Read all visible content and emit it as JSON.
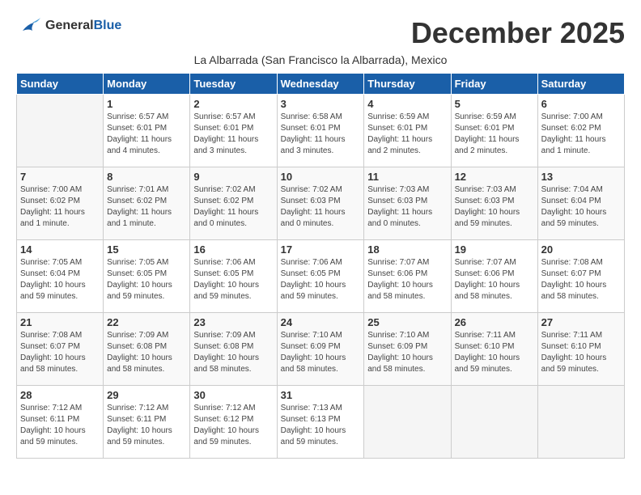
{
  "header": {
    "logo": {
      "general": "General",
      "blue": "Blue"
    },
    "month_title": "December 2025",
    "subtitle": "La Albarrada (San Francisco la Albarrada), Mexico"
  },
  "calendar": {
    "days_of_week": [
      "Sunday",
      "Monday",
      "Tuesday",
      "Wednesday",
      "Thursday",
      "Friday",
      "Saturday"
    ],
    "weeks": [
      [
        {
          "day": "",
          "info": ""
        },
        {
          "day": "1",
          "info": "Sunrise: 6:57 AM\nSunset: 6:01 PM\nDaylight: 11 hours\nand 4 minutes."
        },
        {
          "day": "2",
          "info": "Sunrise: 6:57 AM\nSunset: 6:01 PM\nDaylight: 11 hours\nand 3 minutes."
        },
        {
          "day": "3",
          "info": "Sunrise: 6:58 AM\nSunset: 6:01 PM\nDaylight: 11 hours\nand 3 minutes."
        },
        {
          "day": "4",
          "info": "Sunrise: 6:59 AM\nSunset: 6:01 PM\nDaylight: 11 hours\nand 2 minutes."
        },
        {
          "day": "5",
          "info": "Sunrise: 6:59 AM\nSunset: 6:01 PM\nDaylight: 11 hours\nand 2 minutes."
        },
        {
          "day": "6",
          "info": "Sunrise: 7:00 AM\nSunset: 6:02 PM\nDaylight: 11 hours\nand 1 minute."
        }
      ],
      [
        {
          "day": "7",
          "info": "Sunrise: 7:00 AM\nSunset: 6:02 PM\nDaylight: 11 hours\nand 1 minute."
        },
        {
          "day": "8",
          "info": "Sunrise: 7:01 AM\nSunset: 6:02 PM\nDaylight: 11 hours\nand 1 minute."
        },
        {
          "day": "9",
          "info": "Sunrise: 7:02 AM\nSunset: 6:02 PM\nDaylight: 11 hours\nand 0 minutes."
        },
        {
          "day": "10",
          "info": "Sunrise: 7:02 AM\nSunset: 6:03 PM\nDaylight: 11 hours\nand 0 minutes."
        },
        {
          "day": "11",
          "info": "Sunrise: 7:03 AM\nSunset: 6:03 PM\nDaylight: 11 hours\nand 0 minutes."
        },
        {
          "day": "12",
          "info": "Sunrise: 7:03 AM\nSunset: 6:03 PM\nDaylight: 10 hours\nand 59 minutes."
        },
        {
          "day": "13",
          "info": "Sunrise: 7:04 AM\nSunset: 6:04 PM\nDaylight: 10 hours\nand 59 minutes."
        }
      ],
      [
        {
          "day": "14",
          "info": "Sunrise: 7:05 AM\nSunset: 6:04 PM\nDaylight: 10 hours\nand 59 minutes."
        },
        {
          "day": "15",
          "info": "Sunrise: 7:05 AM\nSunset: 6:05 PM\nDaylight: 10 hours\nand 59 minutes."
        },
        {
          "day": "16",
          "info": "Sunrise: 7:06 AM\nSunset: 6:05 PM\nDaylight: 10 hours\nand 59 minutes."
        },
        {
          "day": "17",
          "info": "Sunrise: 7:06 AM\nSunset: 6:05 PM\nDaylight: 10 hours\nand 59 minutes."
        },
        {
          "day": "18",
          "info": "Sunrise: 7:07 AM\nSunset: 6:06 PM\nDaylight: 10 hours\nand 58 minutes."
        },
        {
          "day": "19",
          "info": "Sunrise: 7:07 AM\nSunset: 6:06 PM\nDaylight: 10 hours\nand 58 minutes."
        },
        {
          "day": "20",
          "info": "Sunrise: 7:08 AM\nSunset: 6:07 PM\nDaylight: 10 hours\nand 58 minutes."
        }
      ],
      [
        {
          "day": "21",
          "info": "Sunrise: 7:08 AM\nSunset: 6:07 PM\nDaylight: 10 hours\nand 58 minutes."
        },
        {
          "day": "22",
          "info": "Sunrise: 7:09 AM\nSunset: 6:08 PM\nDaylight: 10 hours\nand 58 minutes."
        },
        {
          "day": "23",
          "info": "Sunrise: 7:09 AM\nSunset: 6:08 PM\nDaylight: 10 hours\nand 58 minutes."
        },
        {
          "day": "24",
          "info": "Sunrise: 7:10 AM\nSunset: 6:09 PM\nDaylight: 10 hours\nand 58 minutes."
        },
        {
          "day": "25",
          "info": "Sunrise: 7:10 AM\nSunset: 6:09 PM\nDaylight: 10 hours\nand 58 minutes."
        },
        {
          "day": "26",
          "info": "Sunrise: 7:11 AM\nSunset: 6:10 PM\nDaylight: 10 hours\nand 59 minutes."
        },
        {
          "day": "27",
          "info": "Sunrise: 7:11 AM\nSunset: 6:10 PM\nDaylight: 10 hours\nand 59 minutes."
        }
      ],
      [
        {
          "day": "28",
          "info": "Sunrise: 7:12 AM\nSunset: 6:11 PM\nDaylight: 10 hours\nand 59 minutes."
        },
        {
          "day": "29",
          "info": "Sunrise: 7:12 AM\nSunset: 6:11 PM\nDaylight: 10 hours\nand 59 minutes."
        },
        {
          "day": "30",
          "info": "Sunrise: 7:12 AM\nSunset: 6:12 PM\nDaylight: 10 hours\nand 59 minutes."
        },
        {
          "day": "31",
          "info": "Sunrise: 7:13 AM\nSunset: 6:13 PM\nDaylight: 10 hours\nand 59 minutes."
        },
        {
          "day": "",
          "info": ""
        },
        {
          "day": "",
          "info": ""
        },
        {
          "day": "",
          "info": ""
        }
      ]
    ]
  }
}
